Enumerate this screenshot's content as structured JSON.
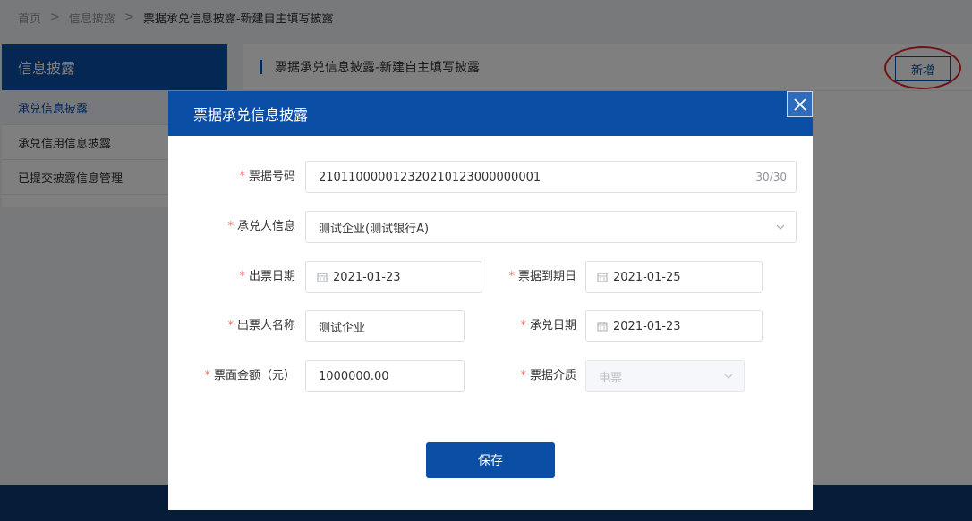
{
  "breadcrumb": {
    "items": [
      "首页",
      "信息披露",
      "票据承兑信息披露-新建自主填写披露"
    ],
    "separator": ">"
  },
  "sidebar": {
    "title": "信息披露",
    "items": [
      {
        "label": "承兑信息披露",
        "active": true
      },
      {
        "label": "承兑信用信息披露",
        "active": false
      },
      {
        "label": "已提交披露信息管理",
        "active": false
      }
    ]
  },
  "content": {
    "title": "票据承兑信息披露-新建自主填写披露",
    "new_button": "新增"
  },
  "modal": {
    "title": "票据承兑信息披露",
    "required_mark": "*",
    "fields": {
      "bill_no": {
        "label": "票据号码",
        "value": "210110000012320210123000000001",
        "count": "30/30"
      },
      "acceptor": {
        "label": "承兑人信息",
        "value": "测试企业(测试银行A)"
      },
      "issue_date": {
        "label": "出票日期",
        "value": "2021-01-23"
      },
      "due_date": {
        "label": "票据到期日",
        "value": "2021-01-25"
      },
      "drawer_name": {
        "label": "出票人名称",
        "value": "测试企业"
      },
      "accept_date": {
        "label": "承兑日期",
        "value": "2021-01-23"
      },
      "amount": {
        "label": "票面金额（元）",
        "value": "1000000.00"
      },
      "medium": {
        "label": "票据介质",
        "value": "电票"
      }
    },
    "save_button": "保存"
  },
  "colors": {
    "primary": "#0a4ea6",
    "highlight_circle": "#e0262b",
    "required": "#f56c6c"
  },
  "icons": {
    "close": "close-icon",
    "calendar": "calendar-icon",
    "dropdown": "chevron-down-icon"
  }
}
